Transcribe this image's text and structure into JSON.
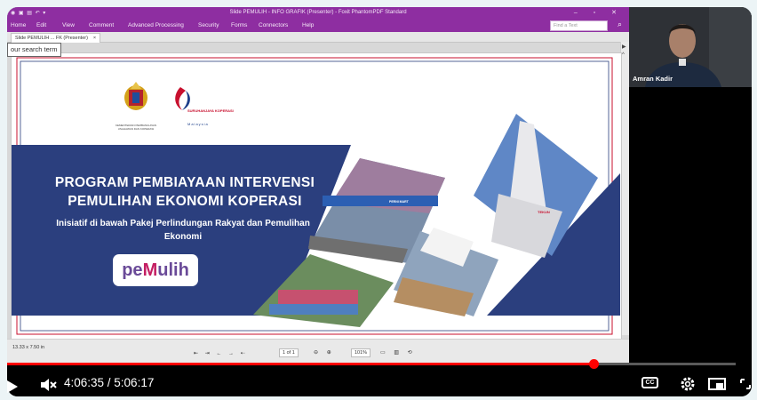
{
  "app": {
    "window_title": "Slide PEMULIH - INFO GRAFIK (Presenter) - Foxit PhantomPDF Standard",
    "menu": [
      "Home",
      "Edit",
      "View",
      "Comment",
      "Advanced Processing",
      "Security",
      "Forms",
      "Connectors",
      "Help"
    ],
    "find_placeholder": "Find a Text",
    "tab_label": "Slide PEMULIH ... FK (Presenter)",
    "search_tooltip": "our search term"
  },
  "slide": {
    "title": "PROGRAM PEMBIAYAAN INTERVENSI PEMULIHAN EKONOMI KOPERASI",
    "subtitle": "Inisiatif di bawah Pakej Perlindungan Rakyat dan Pemulihan Ekonomi",
    "logo_left_text": "KEMENTERIAN PEMBANGUNAN USAHAWAN DAN KOPERASI",
    "logo_right_text": "SURUHANJAYA KOPERASI",
    "logo_right_sub": "Malaysia",
    "brand_pe": "pe",
    "brand_m": "M",
    "brand_ulih": "ulih",
    "building_sign": "TEKUN",
    "shop_sign": "PERNI MART"
  },
  "status": {
    "page_size": "13.33 x 7.50 in",
    "page_indicator": "1 of 1",
    "zoom": "101%"
  },
  "webcam": {
    "presenter_name": "Amran Kadir"
  },
  "player": {
    "time_display": "4:06:35 / 5:06:17",
    "progress_fraction": 0.805,
    "cc_label": "CC"
  },
  "colors": {
    "app_accent": "#8e2ea1",
    "slide_band": "#2b3f7e",
    "progress": "#ff0000"
  }
}
